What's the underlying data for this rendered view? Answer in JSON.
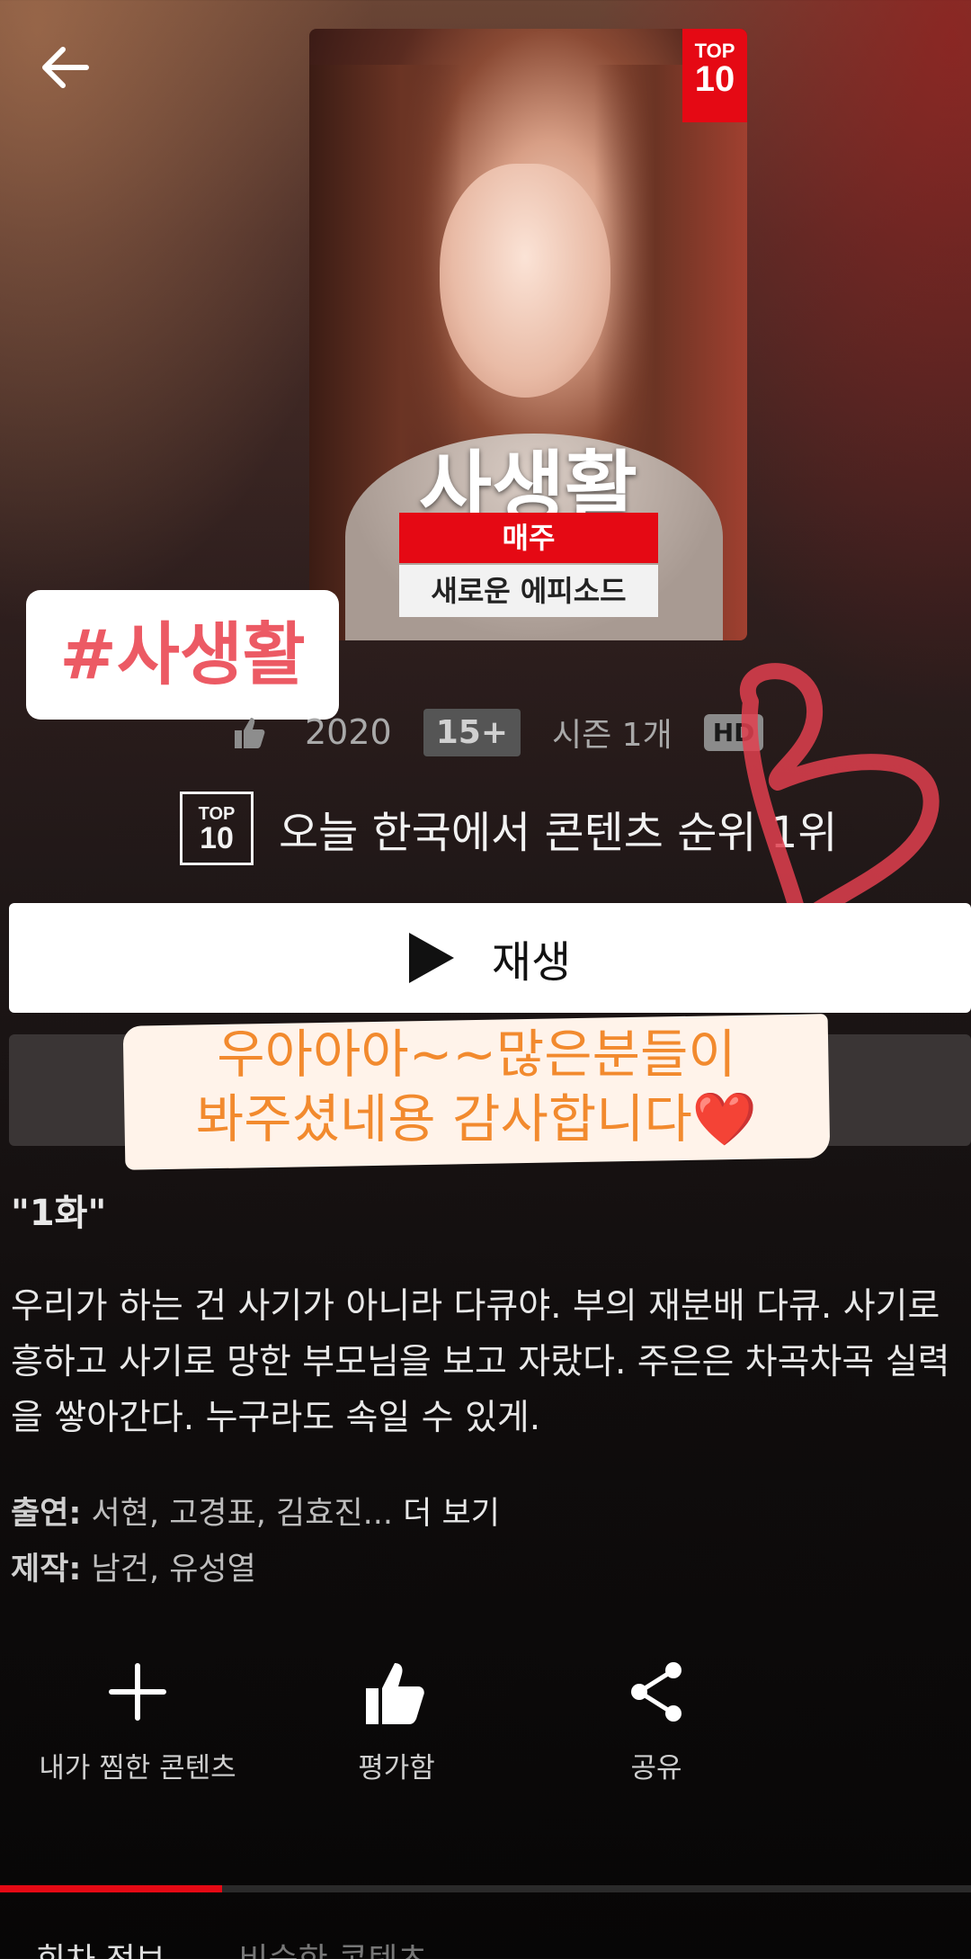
{
  "header": {
    "back_icon": "arrow-left-icon"
  },
  "poster": {
    "badge_top": "TOP",
    "badge_num": "10",
    "title": "사생활",
    "weekly": "매주",
    "new_episodes": "새로운 에피소드"
  },
  "story_overlay": {
    "hashtag": "#사생활",
    "sticker_line1": "우아아아~~많은분들이",
    "sticker_line2": "봐주셨네용 감사합니다❤️",
    "heart_color": "#e0404f"
  },
  "meta": {
    "year": "2020",
    "age_rating": "15+",
    "seasons": "시즌 1개",
    "quality": "HD"
  },
  "rank": {
    "icon_top": "TOP",
    "icon_num": "10",
    "text": "오늘 한국에서 콘텐츠 순위 1위"
  },
  "play_button": {
    "label": "재생"
  },
  "episode": {
    "title": "\"1화\""
  },
  "synopsis": "우리가 하는 건 사기가 아니라 다큐야. 부의 재분배 다큐. 사기로 흥하고 사기로 망한 부모님을 보고 자랐다. 주은은 차곡차곡 실력을 쌓아간다. 누구라도 속일 수 있게.",
  "credits": {
    "cast_label": "출연:",
    "cast": "서현, 고경표, 김효진...",
    "more": "더 보기",
    "creator_label": "제작:",
    "creators": "남건, 유성열"
  },
  "actions": [
    {
      "label": "내가 찜한 콘텐츠",
      "icon": "plus-icon"
    },
    {
      "label": "평가함",
      "icon": "thumbs-up-icon"
    },
    {
      "label": "공유",
      "icon": "share-icon"
    }
  ],
  "tabs": [
    {
      "label": "회차 정보"
    },
    {
      "label": "비슷한 콘텐츠"
    }
  ],
  "colors": {
    "accent": "#e50914",
    "sticker_text": "#f28a2e",
    "hashtag": "#ec5a64"
  }
}
